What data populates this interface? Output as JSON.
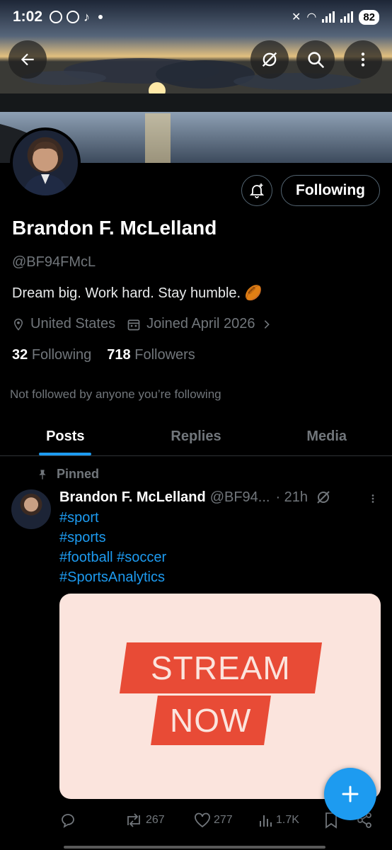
{
  "status_bar": {
    "time": "1:02",
    "battery": "82"
  },
  "profile": {
    "name": "Brandon F. McLelland",
    "handle": "@BF94FMcL",
    "bio": "Dream big. Work hard. Stay humble. 🏉",
    "location": "United States",
    "joined": "Joined April 2026",
    "following_count": "32",
    "following_label": "Following",
    "followers_count": "718",
    "followers_label": "Followers",
    "not_followed_text": "Not followed by anyone you’re following",
    "follow_button_label": "Following"
  },
  "tabs": [
    {
      "label": "Posts",
      "active": true
    },
    {
      "label": "Replies",
      "active": false
    },
    {
      "label": "Media",
      "active": false
    }
  ],
  "post": {
    "pinned_label": "Pinned",
    "author_name": "Brandon F. McLelland",
    "author_handle": "@BF94...",
    "time": "· 21h",
    "tags": [
      "#sport",
      "#sports",
      "#football #soccer",
      "#SportsAnalytics"
    ],
    "media_text_line1": "STREAM",
    "media_text_line2": "NOW",
    "reposts": "267",
    "likes": "277",
    "views": "1.7K"
  },
  "icons": {
    "back": "arrow-left-icon",
    "grok": "grok-icon",
    "search": "search-icon",
    "more": "more-vertical-icon",
    "bell": "bell-plus-icon",
    "location": "location-pin-icon",
    "calendar": "calendar-icon",
    "chevron": "chevron-right-icon",
    "pin": "pin-icon",
    "reply": "reply-icon",
    "repost": "repost-icon",
    "like": "heart-icon",
    "views": "views-icon",
    "bookmark": "bookmark-icon",
    "share": "share-icon",
    "compose": "plus-icon"
  },
  "colors": {
    "accent": "#1d9bf0",
    "stream_red": "#e84b36",
    "media_bg": "#fbe4dd"
  }
}
